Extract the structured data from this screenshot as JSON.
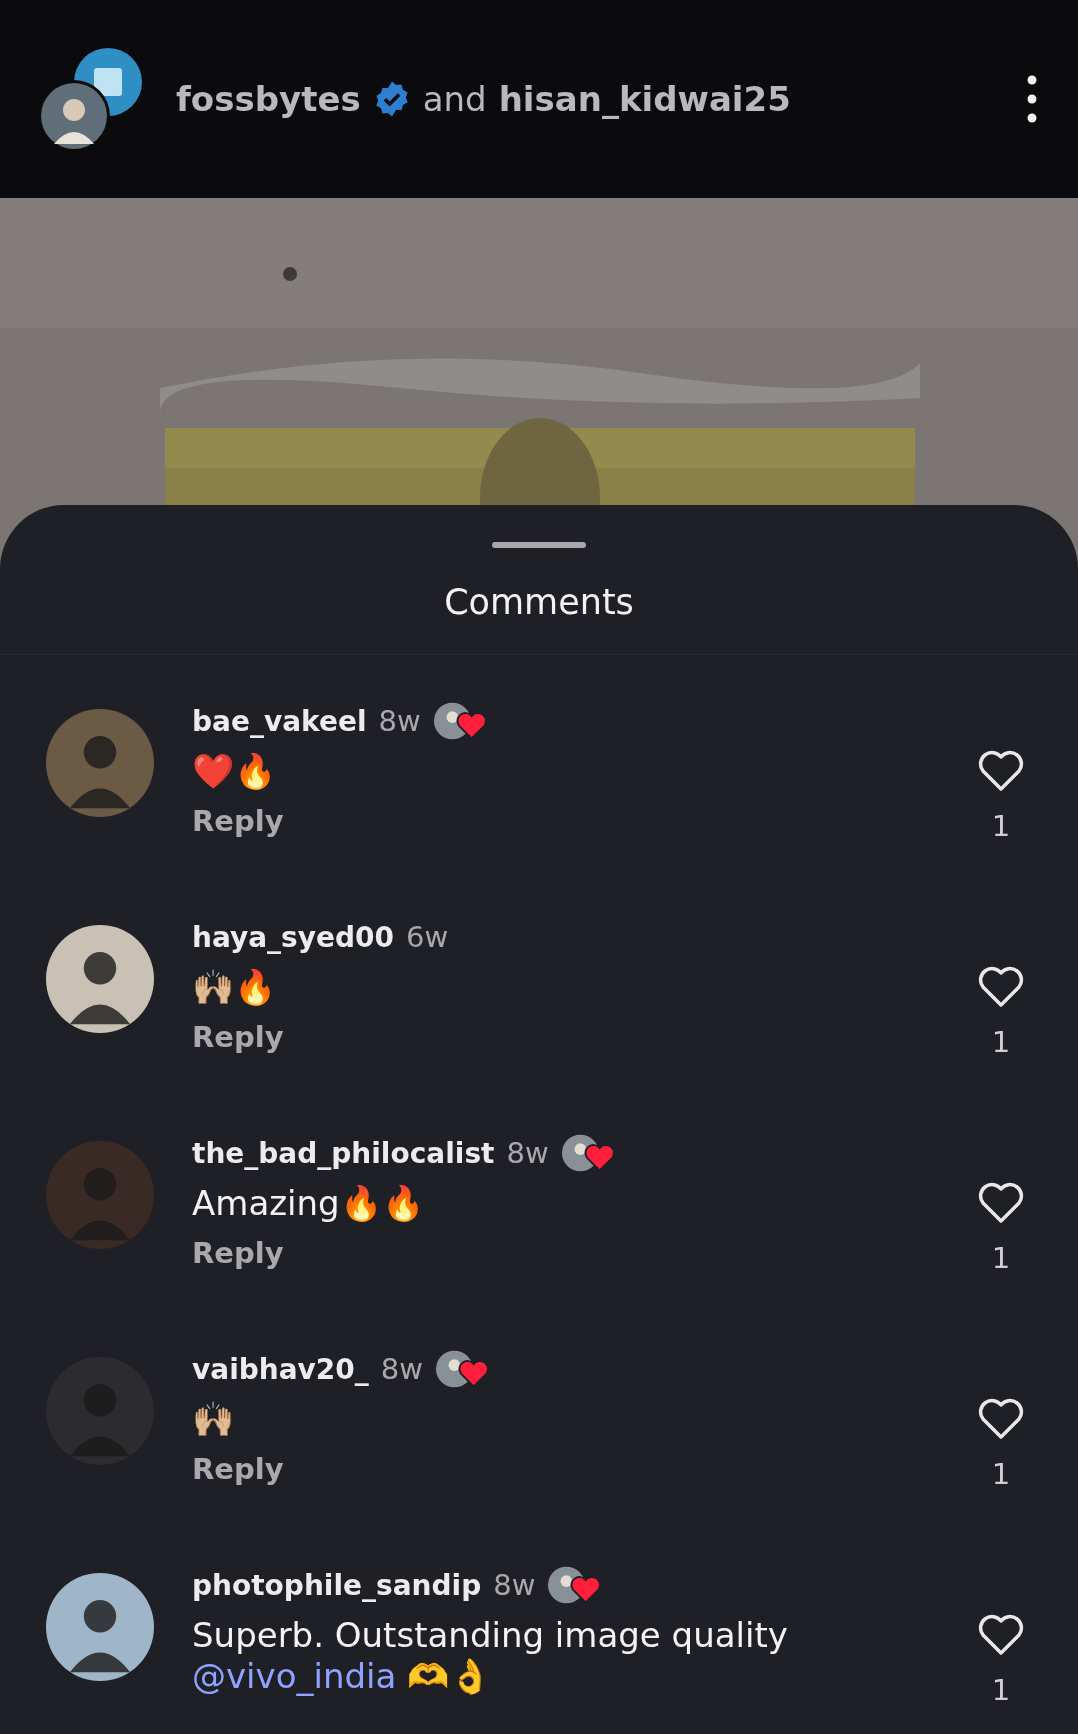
{
  "header": {
    "author": "fossbytes",
    "author_verified": true,
    "connector": "and",
    "collaborator": "hisan_kidwai25"
  },
  "comments_sheet": {
    "title": "Comments",
    "comments": [
      {
        "username": "bae_vakeel",
        "time": "8w",
        "liked_by_author": true,
        "text": "❤️🔥",
        "reply": "Reply",
        "likes": "1",
        "liked": false
      },
      {
        "username": "haya_syed00",
        "time": "6w",
        "liked_by_author": false,
        "text": "🙌🏼🔥",
        "reply": "Reply",
        "likes": "1",
        "liked": false
      },
      {
        "username": "the_bad_philocalist",
        "time": "8w",
        "liked_by_author": true,
        "text": "Amazing🔥🔥",
        "reply": "Reply",
        "likes": "1",
        "liked": false
      },
      {
        "username": "vaibhav20_",
        "time": "8w",
        "liked_by_author": true,
        "text": "🙌🏼",
        "reply": "Reply",
        "likes": "1",
        "liked": false
      },
      {
        "username": "photophile_sandip",
        "time": "8w",
        "liked_by_author": true,
        "text": "Superb. Outstanding image quality",
        "mention": "@vivo_india",
        "text_after": "🫶👌",
        "likes": "1",
        "liked": false
      }
    ]
  }
}
